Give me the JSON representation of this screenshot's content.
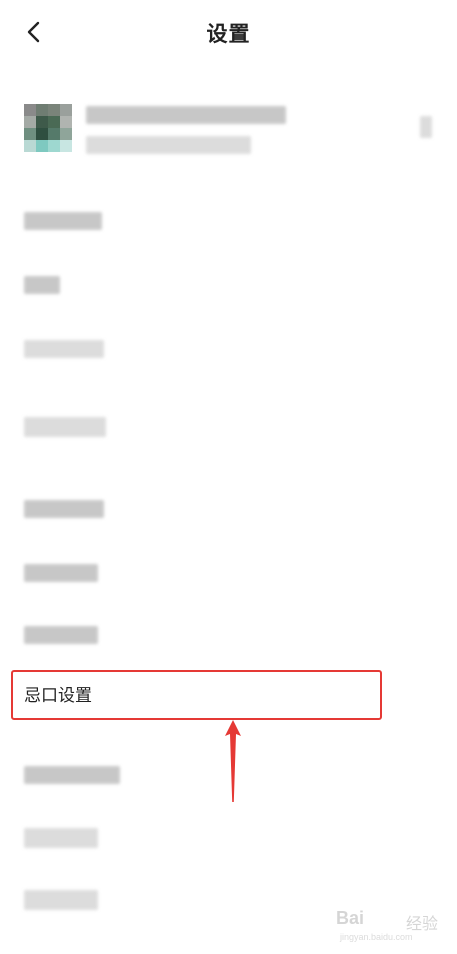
{
  "header": {
    "title": "设置",
    "back_icon": "chevron-left-icon"
  },
  "menu": {
    "highlighted_item_label": "忌口设置"
  },
  "annotation": {
    "box_color": "#e53935",
    "arrow_color": "#e53935"
  },
  "watermark": {
    "logo": "Bai",
    "text": "经验",
    "url": "jingyan.baidu.com"
  }
}
